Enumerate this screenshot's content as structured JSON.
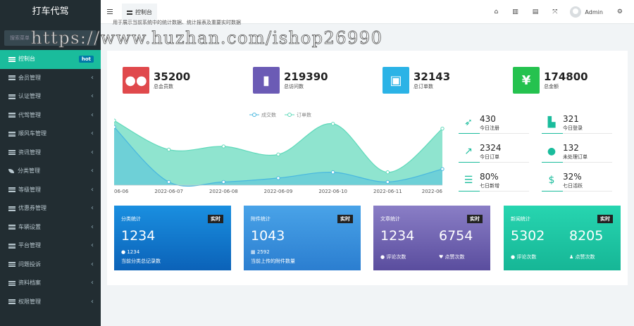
{
  "app": {
    "title": "打车代驾"
  },
  "sidebar": {
    "search_placeholder": "搜索菜单",
    "items": [
      {
        "label": "控制台",
        "badge": "hot",
        "active": true,
        "icon": "list-icon"
      },
      {
        "label": "会员管理",
        "icon": "list-icon"
      },
      {
        "label": "认证管理",
        "icon": "list-icon"
      },
      {
        "label": "代驾管理",
        "icon": "list-icon"
      },
      {
        "label": "顺风车管理",
        "icon": "list-icon"
      },
      {
        "label": "资讯管理",
        "icon": "list-icon"
      },
      {
        "label": "分类管理",
        "icon": "leaf-icon"
      },
      {
        "label": "等级管理",
        "icon": "list-icon"
      },
      {
        "label": "优惠券管理",
        "icon": "list-icon"
      },
      {
        "label": "车辆设置",
        "icon": "list-icon"
      },
      {
        "label": "平台管理",
        "icon": "list-icon"
      },
      {
        "label": "问题投诉",
        "icon": "list-icon"
      },
      {
        "label": "资料档案",
        "icon": "list-icon"
      },
      {
        "label": "权限管理",
        "icon": "list-icon"
      }
    ]
  },
  "topbar": {
    "tab_label": "控制台",
    "user_name": "Admin"
  },
  "watermark": "https://www.huzhan.com/ishop26990",
  "notice": "用于展示当前系统中的统计数据、统计报表及重要实时数据",
  "stats": [
    {
      "value": "35200",
      "label": "总会员数",
      "color": "#e0494c",
      "icon": "users-icon"
    },
    {
      "value": "219390",
      "label": "总访问数",
      "color": "#6b5bb5",
      "icon": "book-icon"
    },
    {
      "value": "32143",
      "label": "总订单数",
      "color": "#2bb3e6",
      "icon": "shopping-bag-icon"
    },
    {
      "value": "174800",
      "label": "总金额",
      "color": "#25c24f",
      "icon": "yen-icon"
    }
  ],
  "kpis": [
    {
      "value": "430",
      "label": "今日注册",
      "icon": "rocket-icon"
    },
    {
      "value": "321",
      "label": "今日登录",
      "icon": "cart-icon"
    },
    {
      "value": "2324",
      "label": "今日订单",
      "icon": "chart-line-icon"
    },
    {
      "value": "132",
      "label": "未处理订单",
      "icon": "users-icon"
    },
    {
      "value": "80%",
      "label": "七日新增",
      "icon": "list-icon"
    },
    {
      "value": "32%",
      "label": "七日活跃",
      "icon": "dollar-icon"
    }
  ],
  "cards": [
    {
      "title": "分类统计",
      "badge": "实时",
      "value": "1234",
      "sub_value": "1234",
      "sub_label": "当前分类总记录数"
    },
    {
      "title": "附件统计",
      "badge": "实时",
      "value": "1043",
      "sub_value": "2592",
      "sub_label": "当前上传的附件数量"
    },
    {
      "title": "文章统计",
      "badge": "实时",
      "value1": "1234",
      "label1": "评论次数",
      "value2": "6754",
      "label2": "点赞次数"
    },
    {
      "title": "新闻统计",
      "badge": "实时",
      "value1": "5302",
      "label1": "评论次数",
      "value2": "8205",
      "label2": "点赞次数"
    }
  ],
  "chart_data": {
    "type": "area",
    "legend": [
      "成交数",
      "订单数"
    ],
    "categories": [
      "06-06",
      "2022-06-07",
      "2022-06-08",
      "2022-06-09",
      "2022-06-10",
      "2022-06-11",
      "2022-06"
    ],
    "series": [
      {
        "name": "成交数",
        "values": [
          180,
          10,
          10,
          22,
          40,
          10,
          50
        ],
        "color": "#48b7df"
      },
      {
        "name": "订单数",
        "values": [
          200,
          110,
          120,
          95,
          190,
          40,
          175
        ],
        "color": "#5fd9ba"
      }
    ],
    "ylim": [
      0,
      220
    ],
    "grid": false,
    "legend_position": "top"
  }
}
